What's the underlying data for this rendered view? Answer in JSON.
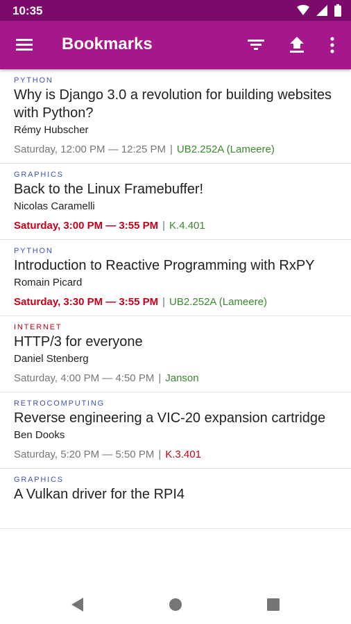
{
  "status_bar": {
    "time": "10:35"
  },
  "app_bar": {
    "title": "Bookmarks",
    "menu_icon": "menu-icon",
    "actions": [
      "filter-icon",
      "upload-icon",
      "more-vert-icon"
    ]
  },
  "colors": {
    "status_bar": "#7b0a6a",
    "app_bar": "#a5178b",
    "current_time": "#c6001b",
    "room_green": "#3a8a2e",
    "room_red": "#c6001b",
    "track_blue": "#3f51b5"
  },
  "bookmarks": [
    {
      "track": "PYTHON",
      "track_color": "#3f51b5",
      "title": "Why is Django 3.0 a revolution for building websites with Python?",
      "speaker": "Rémy Hubscher",
      "time": "Saturday, 12:00 PM — 12:25 PM",
      "separator": "|",
      "room": "UB2.252A (Lameere)",
      "room_color": "#3a8a2e",
      "current": false
    },
    {
      "track": "GRAPHICS",
      "track_color": "#3f51b5",
      "title": "Back to the Linux Framebuffer!",
      "speaker": "Nicolas Caramelli",
      "time": "Saturday, 3:00 PM — 3:55 PM",
      "separator": "|",
      "room": "K.4.401",
      "room_color": "#3a8a2e",
      "current": true
    },
    {
      "track": "PYTHON",
      "track_color": "#3f51b5",
      "title": "Introduction to Reactive Programming with RxPY",
      "speaker": "Romain Picard",
      "time": "Saturday, 3:30 PM — 3:55 PM",
      "separator": "|",
      "room": "UB2.252A (Lameere)",
      "room_color": "#3a8a2e",
      "current": true
    },
    {
      "track": "INTERNET",
      "track_color": "#c6001b",
      "title": "HTTP/3 for everyone",
      "speaker": "Daniel Stenberg",
      "time": "Saturday, 4:00 PM — 4:50 PM",
      "separator": "|",
      "room": "Janson",
      "room_color": "#3a8a2e",
      "current": false
    },
    {
      "track": "RETROCOMPUTING",
      "track_color": "#3f51b5",
      "title": "Reverse engineering a VIC-20 expansion cartridge",
      "speaker": "Ben Dooks",
      "time": "Saturday, 5:20 PM — 5:50 PM",
      "separator": "|",
      "room": "K.3.401",
      "room_color": "#c6001b",
      "current": false
    },
    {
      "track": "GRAPHICS",
      "track_color": "#3f51b5",
      "title": "A Vulkan driver for the RPI4",
      "speaker": "",
      "time": "",
      "separator": "",
      "room": "",
      "room_color": "#3a8a2e",
      "current": false
    }
  ],
  "nav_bar": {
    "buttons": [
      "back-icon",
      "home-icon",
      "recents-icon"
    ]
  }
}
